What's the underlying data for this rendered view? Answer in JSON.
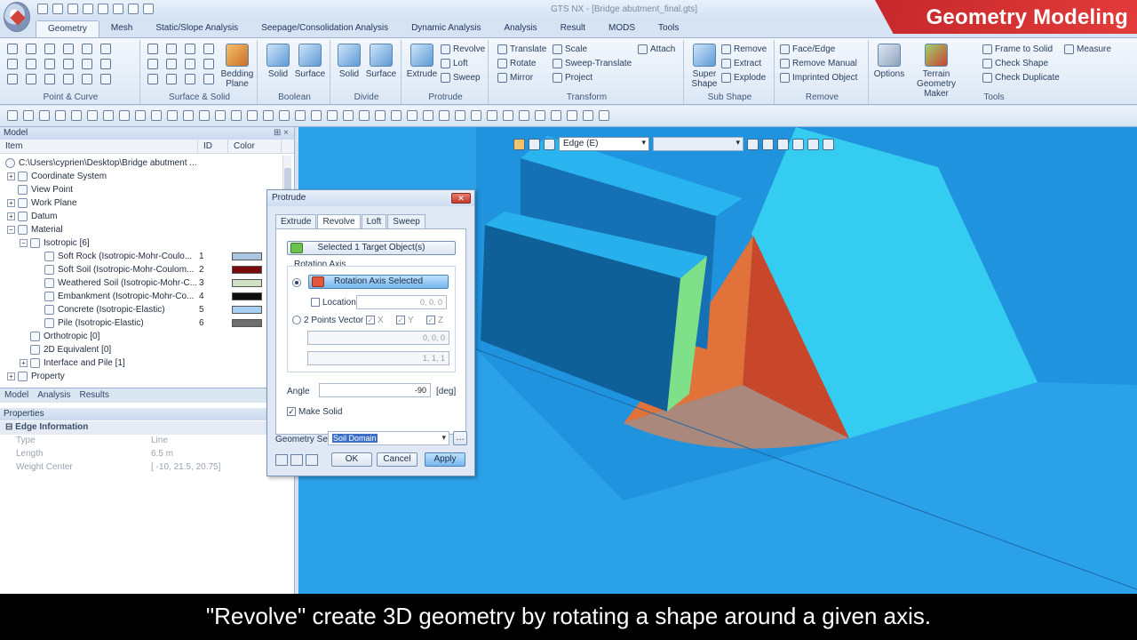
{
  "window": {
    "title": "GTS NX - [Bridge abutment_final.gts]"
  },
  "banner": {
    "text": "Geometry Modeling"
  },
  "ribbon_tabs": [
    "Geometry",
    "Mesh",
    "Static/Slope Analysis",
    "Seepage/Consolidation Analysis",
    "Dynamic Analysis",
    "Analysis",
    "Result",
    "MODS",
    "Tools"
  ],
  "ribbon": {
    "point_curve": "Point & Curve",
    "surface_solid": "Surface & Solid",
    "bedding_plane": "Bedding Plane",
    "boolean": {
      "label": "Boolean",
      "solid": "Solid",
      "surface": "Surface"
    },
    "divide": {
      "label": "Divide",
      "solid": "Solid",
      "surface": "Surface"
    },
    "protrude": {
      "label": "Protrude",
      "extrude": "Extrude",
      "revolve": "Revolve",
      "loft": "Loft",
      "sweep": "Sweep"
    },
    "transform": {
      "label": "Transform",
      "translate": "Translate",
      "rotate": "Rotate",
      "mirror": "Mirror",
      "scale": "Scale",
      "sweep_translate": "Sweep-Translate",
      "project": "Project",
      "attach": "Attach"
    },
    "sub_shape": {
      "label": "Sub Shape",
      "super_shape": "Super Shape",
      "remove": "Remove",
      "extract": "Extract",
      "explode": "Explode"
    },
    "remove": {
      "label": "Remove",
      "face_edge": "Face/Edge",
      "remove_manual": "Remove Manual",
      "imprinted_object": "Imprinted Object"
    },
    "tools": {
      "label": "Tools",
      "options": "Options",
      "terrain": "Terrain Geometry Maker",
      "frame_to_solid": "Frame to Solid",
      "check_shape": "Check Shape",
      "check_duplicate": "Check Duplicate",
      "measure": "Measure"
    }
  },
  "model_panel": {
    "title": "Model",
    "columns": [
      "Item",
      "ID",
      "Color"
    ],
    "path": "C:\\Users\\cyprien\\Desktop\\Bridge abutment ...",
    "items": [
      "Coordinate System",
      "View Point",
      "Work Plane",
      "Datum",
      "Material",
      "Isotropic [6]"
    ],
    "materials": [
      {
        "name": "Soft Rock (Isotropic-Mohr-Coulo...",
        "id": "1",
        "color": "#a9c6e3"
      },
      {
        "name": "Soft Soil (Isotropic-Mohr-Coulom...",
        "id": "2",
        "color": "#7a0c0c"
      },
      {
        "name": "Weathered Soil (Isotropic-Mohr-C...",
        "id": "3",
        "color": "#cfe0c4"
      },
      {
        "name": "Embankment (Isotropic-Mohr-Co...",
        "id": "4",
        "color": "#0d0d0d"
      },
      {
        "name": "Concrete (Isotropic-Elastic)",
        "id": "5",
        "color": "#a9cff2"
      },
      {
        "name": "Pile (Isotropic-Elastic)",
        "id": "6",
        "color": "#6e6e6e"
      }
    ],
    "more": [
      "Orthotropic [0]",
      "2D Equivalent [0]",
      "Interface and Pile [1]",
      "Property"
    ],
    "bottom_tabs": [
      "Model",
      "Analysis",
      "Results"
    ]
  },
  "properties": {
    "title": "Properties",
    "section": "Edge Information",
    "rows": [
      {
        "key": "Type",
        "value": "Line"
      },
      {
        "key": "Length",
        "value": "6.5 m"
      },
      {
        "key": "Weight Center",
        "value": "[ -10,  21.5, 20.75]"
      }
    ]
  },
  "viewport": {
    "filter_value": "Edge (E)"
  },
  "dialog": {
    "title": "Protrude",
    "tabs": [
      "Extrude",
      "Revolve",
      "Loft",
      "Sweep"
    ],
    "target_button": "Selected 1 Target Object(s)",
    "rotation_axis_label": "Rotation Axis",
    "axis_selected_button": "Rotation Axis Selected",
    "location_label": "Location",
    "location_value": "0, 0, 0",
    "two_points_label": "2 Points Vector",
    "x_label": "X",
    "y_label": "Y",
    "z_label": "Z",
    "pt1_value": "0, 0, 0",
    "pt2_value": "1, 1, 1",
    "angle_label": "Angle",
    "angle_value": "-90",
    "angle_unit": "[deg]",
    "make_solid_label": "Make Solid",
    "geometry_set_label": "Geometry Set",
    "geometry_set_value": "Soil Domain",
    "ok": "OK",
    "cancel": "Cancel",
    "apply": "Apply"
  },
  "subtitle": "\"Revolve\" create 3D geometry by rotating a shape around a given axis."
}
